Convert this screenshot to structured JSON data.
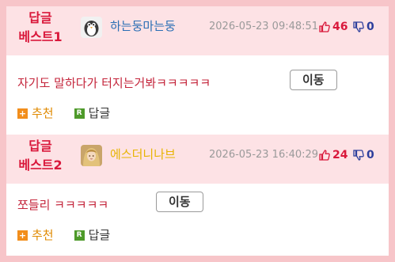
{
  "colors": {
    "accent_red": "#d9183b",
    "header_pink": "#fde2e5",
    "border_pink": "#f7c5c9",
    "nick_blue": "#2a6fb5",
    "nick_gold": "#e7b400",
    "comment_red": "#c4253b",
    "recommend_orange": "#e08a00",
    "reply_green": "#4e9a2a"
  },
  "comments": [
    {
      "rank_line1": "답글",
      "rank_line2": "베스트1",
      "avatar_icon": "penguin-avatar",
      "nickname": "하는둥마는둥",
      "timestamp": "2026-05-23 09:48:51",
      "upvotes": "46",
      "downvotes": "0",
      "text": "자기도 말하다가 터지는거봐ㅋㅋㅋㅋㅋ",
      "move_label": "이동",
      "recommend_label": "추천",
      "recommend_icon_glyph": "+",
      "reply_label": "답글",
      "reply_icon_glyph": "R"
    },
    {
      "rank_line1": "답글",
      "rank_line2": "베스트2",
      "avatar_icon": "character-avatar",
      "nickname": "에스더니나브",
      "timestamp": "2026-05-23 16:40:29",
      "upvotes": "24",
      "downvotes": "0",
      "text": "쪼들리 ㅋㅋㅋㅋㅋ",
      "move_label": "이동",
      "recommend_label": "추천",
      "recommend_icon_glyph": "+",
      "reply_label": "답글",
      "reply_icon_glyph": "R"
    }
  ]
}
